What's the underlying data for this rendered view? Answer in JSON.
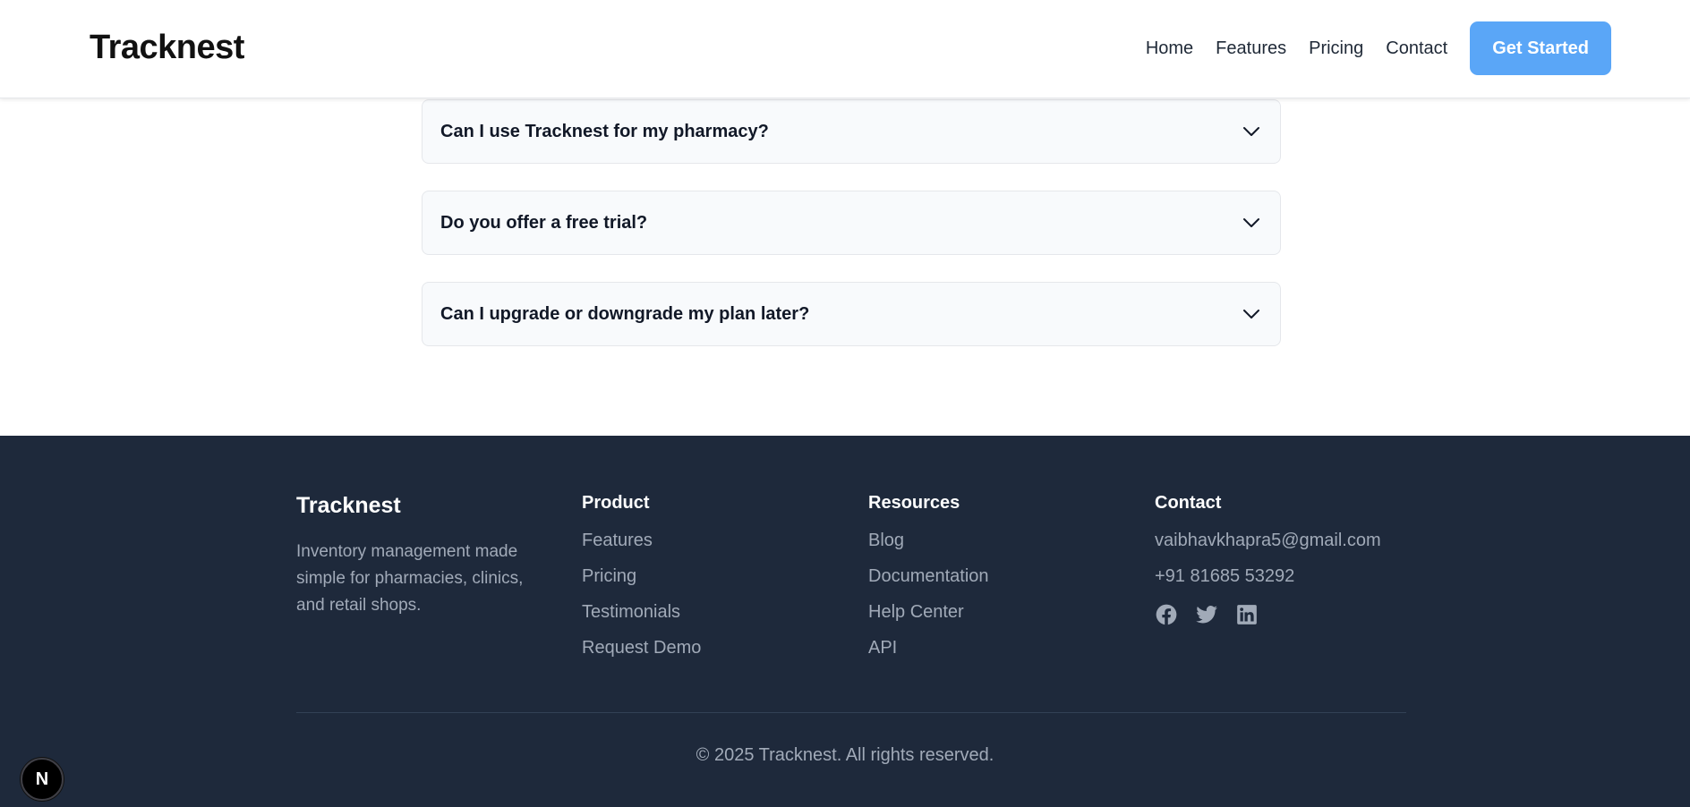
{
  "header": {
    "logo": "Tracknest",
    "nav": [
      "Home",
      "Features",
      "Pricing",
      "Contact"
    ],
    "cta": "Get Started"
  },
  "faq": [
    {
      "question": "Can I use Tracknest for my pharmacy?",
      "icon": "chevron-down-icon"
    },
    {
      "question": "Do you offer a free trial?",
      "icon": "chevron-down-icon"
    },
    {
      "question": "Can I upgrade or downgrade my plan later?",
      "icon": "chevron-down-icon"
    }
  ],
  "footer": {
    "brand": "Tracknest",
    "description": "Inventory management made simple for pharmacies, clinics, and retail shops.",
    "product": {
      "title": "Product",
      "links": [
        "Features",
        "Pricing",
        "Testimonials",
        "Request Demo"
      ]
    },
    "resources": {
      "title": "Resources",
      "links": [
        "Blog",
        "Documentation",
        "Help Center",
        "API"
      ]
    },
    "contact": {
      "title": "Contact",
      "email": "vaibhavkhapra5@gmail.com",
      "phone": "+91 81685 53292",
      "social": [
        "facebook-icon",
        "twitter-icon",
        "linkedin-icon"
      ]
    },
    "copyright": "© 2025 Tracknest. All rights reserved."
  },
  "badge": "N",
  "colors": {
    "accent": "#5aa6f7",
    "footer_bg": "#1e293b",
    "footer_text": "#a1aab8",
    "faq_bg": "#f8fafc"
  }
}
